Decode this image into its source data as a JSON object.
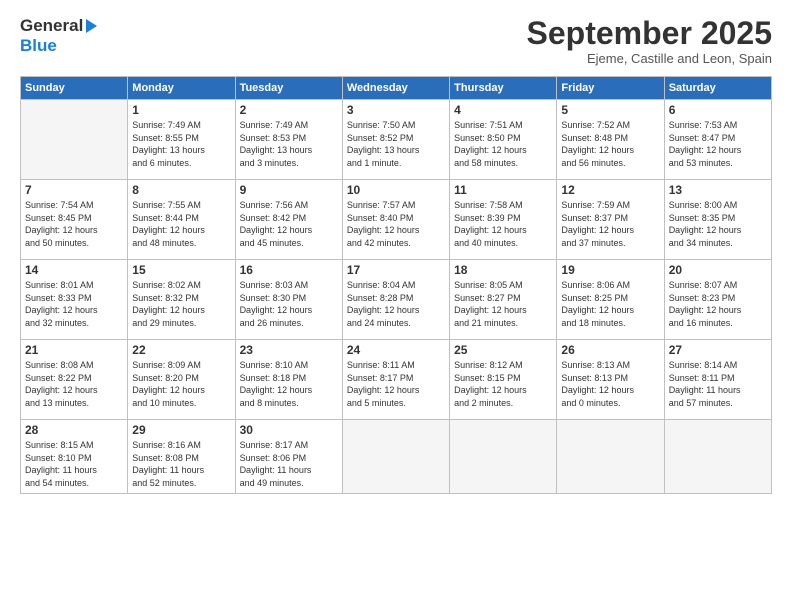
{
  "header": {
    "logo_line1": "General",
    "logo_line2": "Blue",
    "title": "September 2025",
    "subtitle": "Ejeme, Castille and Leon, Spain"
  },
  "days_of_week": [
    "Sunday",
    "Monday",
    "Tuesday",
    "Wednesday",
    "Thursday",
    "Friday",
    "Saturday"
  ],
  "weeks": [
    [
      {
        "day": "",
        "info": ""
      },
      {
        "day": "1",
        "info": "Sunrise: 7:49 AM\nSunset: 8:55 PM\nDaylight: 13 hours\nand 6 minutes."
      },
      {
        "day": "2",
        "info": "Sunrise: 7:49 AM\nSunset: 8:53 PM\nDaylight: 13 hours\nand 3 minutes."
      },
      {
        "day": "3",
        "info": "Sunrise: 7:50 AM\nSunset: 8:52 PM\nDaylight: 13 hours\nand 1 minute."
      },
      {
        "day": "4",
        "info": "Sunrise: 7:51 AM\nSunset: 8:50 PM\nDaylight: 12 hours\nand 58 minutes."
      },
      {
        "day": "5",
        "info": "Sunrise: 7:52 AM\nSunset: 8:48 PM\nDaylight: 12 hours\nand 56 minutes."
      },
      {
        "day": "6",
        "info": "Sunrise: 7:53 AM\nSunset: 8:47 PM\nDaylight: 12 hours\nand 53 minutes."
      }
    ],
    [
      {
        "day": "7",
        "info": "Sunrise: 7:54 AM\nSunset: 8:45 PM\nDaylight: 12 hours\nand 50 minutes."
      },
      {
        "day": "8",
        "info": "Sunrise: 7:55 AM\nSunset: 8:44 PM\nDaylight: 12 hours\nand 48 minutes."
      },
      {
        "day": "9",
        "info": "Sunrise: 7:56 AM\nSunset: 8:42 PM\nDaylight: 12 hours\nand 45 minutes."
      },
      {
        "day": "10",
        "info": "Sunrise: 7:57 AM\nSunset: 8:40 PM\nDaylight: 12 hours\nand 42 minutes."
      },
      {
        "day": "11",
        "info": "Sunrise: 7:58 AM\nSunset: 8:39 PM\nDaylight: 12 hours\nand 40 minutes."
      },
      {
        "day": "12",
        "info": "Sunrise: 7:59 AM\nSunset: 8:37 PM\nDaylight: 12 hours\nand 37 minutes."
      },
      {
        "day": "13",
        "info": "Sunrise: 8:00 AM\nSunset: 8:35 PM\nDaylight: 12 hours\nand 34 minutes."
      }
    ],
    [
      {
        "day": "14",
        "info": "Sunrise: 8:01 AM\nSunset: 8:33 PM\nDaylight: 12 hours\nand 32 minutes."
      },
      {
        "day": "15",
        "info": "Sunrise: 8:02 AM\nSunset: 8:32 PM\nDaylight: 12 hours\nand 29 minutes."
      },
      {
        "day": "16",
        "info": "Sunrise: 8:03 AM\nSunset: 8:30 PM\nDaylight: 12 hours\nand 26 minutes."
      },
      {
        "day": "17",
        "info": "Sunrise: 8:04 AM\nSunset: 8:28 PM\nDaylight: 12 hours\nand 24 minutes."
      },
      {
        "day": "18",
        "info": "Sunrise: 8:05 AM\nSunset: 8:27 PM\nDaylight: 12 hours\nand 21 minutes."
      },
      {
        "day": "19",
        "info": "Sunrise: 8:06 AM\nSunset: 8:25 PM\nDaylight: 12 hours\nand 18 minutes."
      },
      {
        "day": "20",
        "info": "Sunrise: 8:07 AM\nSunset: 8:23 PM\nDaylight: 12 hours\nand 16 minutes."
      }
    ],
    [
      {
        "day": "21",
        "info": "Sunrise: 8:08 AM\nSunset: 8:22 PM\nDaylight: 12 hours\nand 13 minutes."
      },
      {
        "day": "22",
        "info": "Sunrise: 8:09 AM\nSunset: 8:20 PM\nDaylight: 12 hours\nand 10 minutes."
      },
      {
        "day": "23",
        "info": "Sunrise: 8:10 AM\nSunset: 8:18 PM\nDaylight: 12 hours\nand 8 minutes."
      },
      {
        "day": "24",
        "info": "Sunrise: 8:11 AM\nSunset: 8:17 PM\nDaylight: 12 hours\nand 5 minutes."
      },
      {
        "day": "25",
        "info": "Sunrise: 8:12 AM\nSunset: 8:15 PM\nDaylight: 12 hours\nand 2 minutes."
      },
      {
        "day": "26",
        "info": "Sunrise: 8:13 AM\nSunset: 8:13 PM\nDaylight: 12 hours\nand 0 minutes."
      },
      {
        "day": "27",
        "info": "Sunrise: 8:14 AM\nSunset: 8:11 PM\nDaylight: 11 hours\nand 57 minutes."
      }
    ],
    [
      {
        "day": "28",
        "info": "Sunrise: 8:15 AM\nSunset: 8:10 PM\nDaylight: 11 hours\nand 54 minutes."
      },
      {
        "day": "29",
        "info": "Sunrise: 8:16 AM\nSunset: 8:08 PM\nDaylight: 11 hours\nand 52 minutes."
      },
      {
        "day": "30",
        "info": "Sunrise: 8:17 AM\nSunset: 8:06 PM\nDaylight: 11 hours\nand 49 minutes."
      },
      {
        "day": "",
        "info": ""
      },
      {
        "day": "",
        "info": ""
      },
      {
        "day": "",
        "info": ""
      },
      {
        "day": "",
        "info": ""
      }
    ]
  ]
}
